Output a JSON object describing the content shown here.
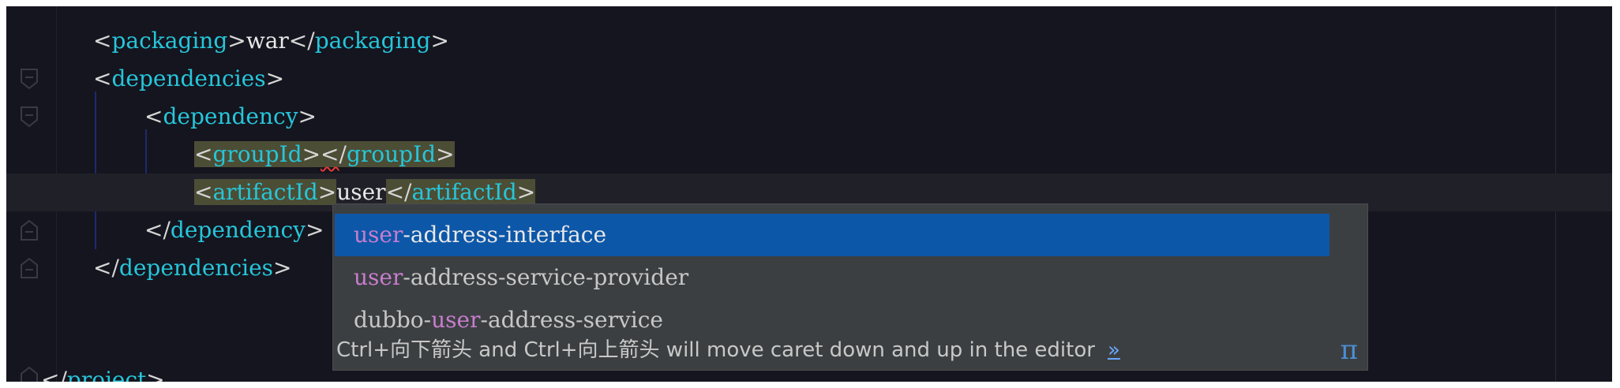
{
  "editor": {
    "lines": [
      {
        "type": "packaging",
        "tag": "packaging",
        "value": "war"
      },
      {
        "type": "open",
        "tag": "dependencies"
      },
      {
        "type": "open",
        "tag": "dependency"
      },
      {
        "type": "element",
        "tag": "groupId",
        "value": ""
      },
      {
        "type": "element",
        "tag": "artifactId",
        "value": "user"
      },
      {
        "type": "close",
        "tag": "dependency"
      },
      {
        "type": "close",
        "tag": "dependencies"
      },
      {
        "type": "close",
        "tag": "project"
      }
    ]
  },
  "completion": {
    "items": [
      {
        "prefix": "",
        "match": "user",
        "suffix": "-address-interface",
        "selected": true
      },
      {
        "prefix": "",
        "match": "user",
        "suffix": "-address-service-provider",
        "selected": false
      },
      {
        "prefix": "dubbo-",
        "match": "user",
        "suffix": "-address-service",
        "selected": false
      }
    ],
    "hint": "Ctrl+向下箭头 and Ctrl+向上箭头 will move caret down and up in the editor",
    "more_link": "»",
    "pi_icon": "π"
  },
  "colors": {
    "background": "#15151f",
    "tag": "#26c6da",
    "selection": "#0d57a8",
    "match": "#c77dcf",
    "tag_highlight": "#4c4d35"
  }
}
